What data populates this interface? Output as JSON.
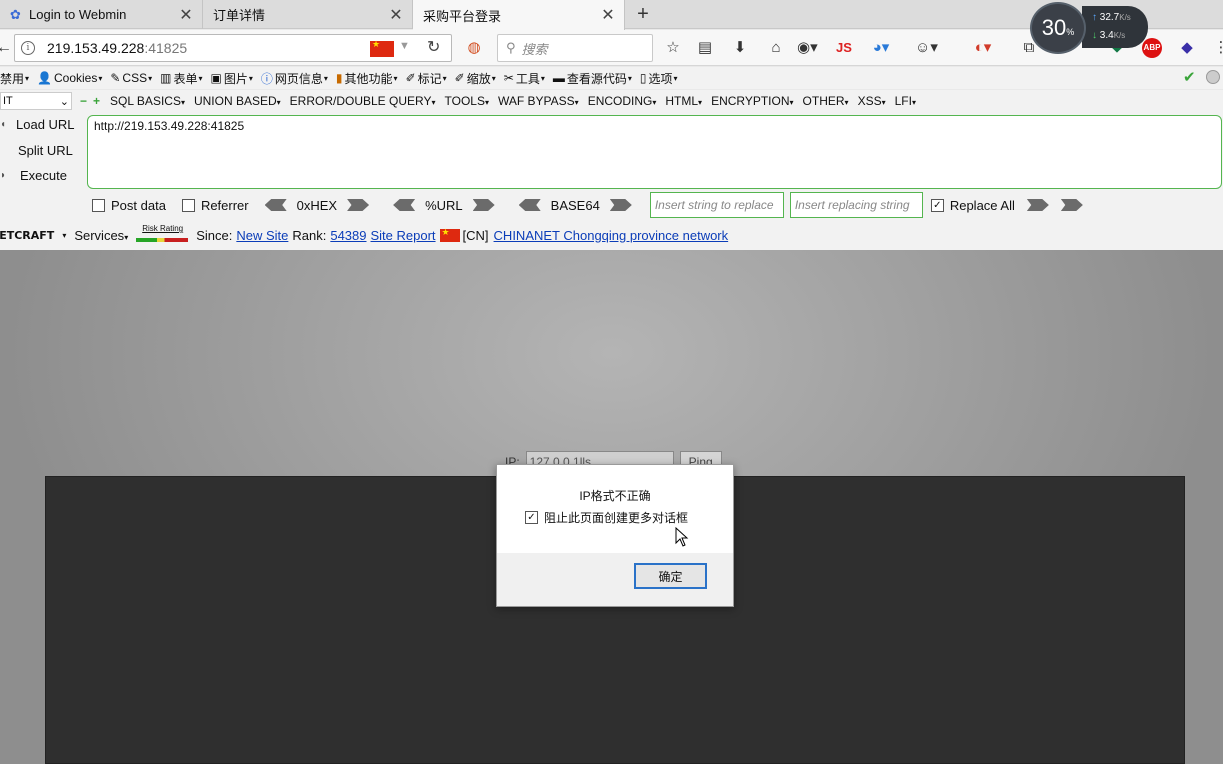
{
  "tabs": [
    {
      "title": "Login to Webmin",
      "icon": "webmin-icon",
      "active": false
    },
    {
      "title": "订单详情",
      "icon": "",
      "active": false
    },
    {
      "title": "采购平台登录",
      "icon": "",
      "active": true
    }
  ],
  "sysmon": {
    "cpu": "30",
    "cpu_unit": "%",
    "up": "32.7",
    "down": "3.4",
    "unit": "K/s"
  },
  "address": {
    "host": "219.153.49.228",
    "port": ":41825"
  },
  "search": {
    "placeholder": "搜索"
  },
  "toolbar_right": {
    "js_label": "JS",
    "abp_label": "ABP"
  },
  "webdev_menu": [
    {
      "label": "禁用",
      "icon": "ban-icon"
    },
    {
      "label": "Cookies",
      "icon": "user-icon"
    },
    {
      "label": "CSS",
      "icon": "pencil-icon"
    },
    {
      "label": "表单",
      "icon": "form-icon"
    },
    {
      "label": "图片",
      "icon": "image-icon"
    },
    {
      "label": "网页信息",
      "icon": "info-icon"
    },
    {
      "label": "其他功能",
      "icon": "book-icon"
    },
    {
      "label": "标记",
      "icon": "pen-icon"
    },
    {
      "label": "缩放",
      "icon": "resize-icon"
    },
    {
      "label": "工具",
      "icon": "wrench-icon"
    },
    {
      "label": "查看源代码",
      "icon": "monitor-icon"
    },
    {
      "label": "选项",
      "icon": "options-icon"
    }
  ],
  "hackbar": {
    "select_value": "IT",
    "menus": [
      "SQL BASICS",
      "UNION BASED",
      "ERROR/DOUBLE QUERY",
      "TOOLS",
      "WAF BYPASS",
      "ENCODING",
      "HTML",
      "ENCRYPTION",
      "OTHER",
      "XSS",
      "LFI"
    ],
    "load_url": "Load URL",
    "split_url": "Split URL",
    "execute": "Execute",
    "url_value": "http://219.153.49.228:41825",
    "post_data": "Post data",
    "referrer": "Referrer",
    "hex": "0xHEX",
    "url_enc": "%URL",
    "base64": "BASE64",
    "replace_placeholder": "Insert string to replace",
    "replacing_placeholder": "Insert replacing string",
    "replace_all": "Replace All"
  },
  "netcraft": {
    "logo": "NETCRAFT",
    "services": "Services",
    "risk": "Risk Rating",
    "since_label": "Since:",
    "since_link": "New Site",
    "rank_label": "Rank:",
    "rank_link": "54389",
    "report_link": "Site Report",
    "country": "[CN]",
    "network_link": "CHINANET Chongqing province network"
  },
  "page": {
    "ip_label": "IP:",
    "ip_value": "127.0.0.1lls",
    "ping_button": "Ping"
  },
  "dialog": {
    "message": "IP格式不正确",
    "suppress": "阻止此页面创建更多对话框",
    "ok": "确定"
  }
}
